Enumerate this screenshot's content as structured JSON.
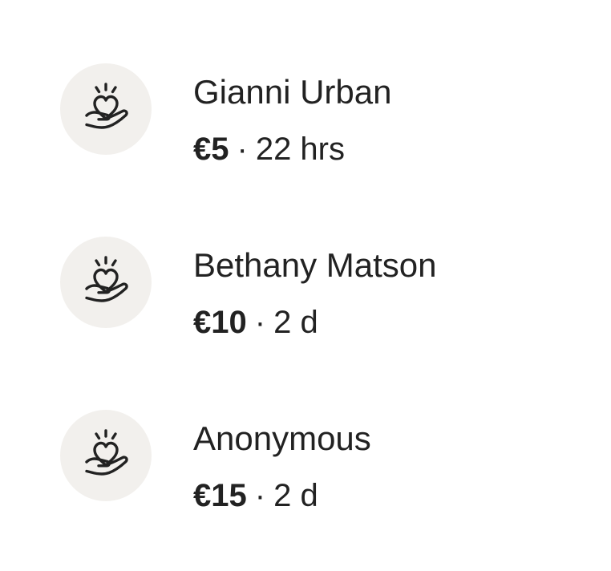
{
  "donations": [
    {
      "name": "Gianni Urban",
      "amount": "€5",
      "separator": "·",
      "time": "22 hrs",
      "icon": "heart-in-hand-icon"
    },
    {
      "name": "Bethany Matson",
      "amount": "€10",
      "separator": "·",
      "time": "2 d",
      "icon": "heart-in-hand-icon"
    },
    {
      "name": "Anonymous",
      "amount": "€15",
      "separator": "·",
      "time": "2 d",
      "icon": "heart-in-hand-icon"
    }
  ],
  "colors": {
    "avatar_background": "#f2f0ed",
    "text": "#222222",
    "background": "#ffffff"
  }
}
